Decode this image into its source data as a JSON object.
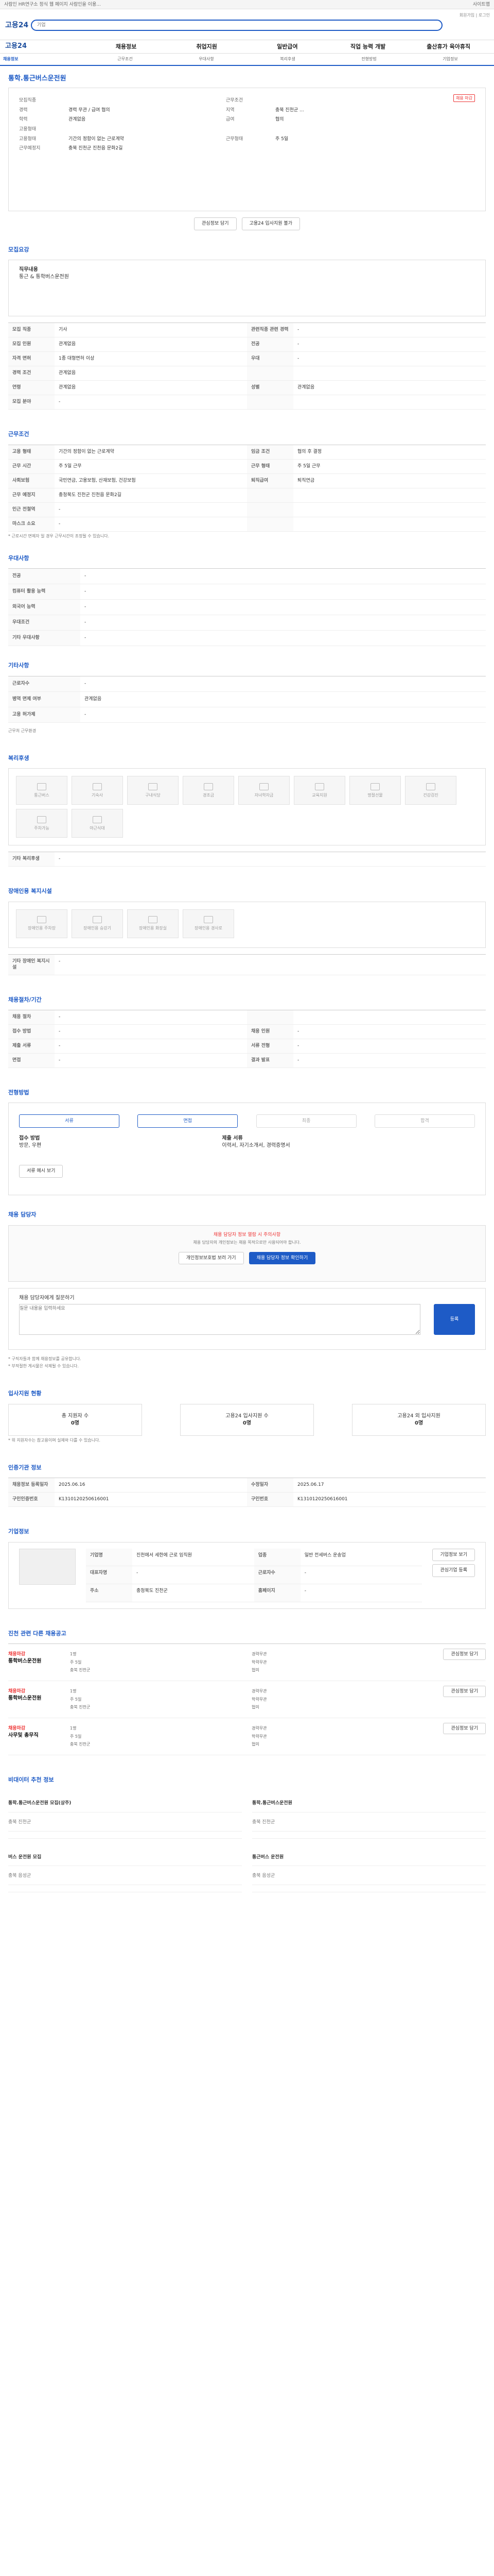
{
  "banner": {
    "text": "사람인 HR연구소 정식 웹 페이지 사람인을 이용...",
    "right": "사이트맵"
  },
  "header": {
    "logo": "고용24",
    "search_placeholder": "기업",
    "links": "회원가입 | 로그인"
  },
  "nav": {
    "items": [
      "고용24",
      "채용정보",
      "취업지원",
      "일반급여",
      "직업 능력 개발",
      "출산휴가 육아휴직"
    ]
  },
  "tabs": {
    "items": [
      "채용정보",
      "근무조건",
      "우대사항",
      "복리후생",
      "전형방법",
      "기업정보"
    ]
  },
  "job": {
    "title": "통학.통근버스운전원",
    "badge": "채용 마감",
    "summary": [
      [
        "모집직종",
        "",
        "근무조건",
        ""
      ],
      [
        "경력",
        "경력 무관 / 급여 협의",
        "지역",
        "충북 진천군 ..."
      ],
      [
        "학력",
        "관계없음",
        "급여",
        "협의"
      ],
      [
        "고용형태",
        "",
        "",
        ""
      ],
      [
        "고용형태",
        "기간의 정함이 없는 근로계약",
        "근무형태",
        "주 5일"
      ],
      [
        "근무예정지",
        "충북 진천군 진천읍 문화2길",
        "",
        ""
      ]
    ]
  },
  "buttons": {
    "save": "관심정보 담기",
    "apply": "고용24 입사지원 불가"
  },
  "recruit": {
    "heading": "모집요강",
    "desc_label": "직무내용",
    "desc": "통근 & 통학버스운전원",
    "rows": [
      [
        "모집 직종",
        "기사",
        "관련직종 관련 경력",
        "-"
      ],
      [
        "모집 인원",
        "관계없음",
        "전공",
        "-"
      ],
      [
        "자격 면허",
        "1종 대형면허 이상",
        "우대",
        "-"
      ],
      [
        "경력 조건",
        "관계없음",
        "",
        ""
      ],
      [
        "연령",
        "관계없음",
        "성별",
        "관계없음"
      ],
      [
        "모집 분야",
        "-",
        "",
        ""
      ]
    ]
  },
  "conditions": {
    "heading": "근무조건",
    "rows": [
      [
        "고용 형태",
        "기간의 정함이 없는 근로계약",
        "임금 조건",
        "협의 후 결정"
      ],
      [
        "근무 시간",
        "주 5일 근무",
        "근무 형태",
        "주 5일 근무"
      ],
      [
        "사회보험",
        "국민연금, 고용보험, 산재보험, 건강보험",
        "퇴직급여",
        "퇴직연금"
      ],
      [
        "근무 예정지",
        "충청북도 진천군 진천읍 문화2길",
        "",
        ""
      ],
      [
        "인근 전철역",
        "-",
        "",
        ""
      ],
      [
        "마스크 소요",
        "-",
        "",
        ""
      ]
    ],
    "note": "* 근로시간 면제자 일 경우 근무시간이 조정될 수 있습니다."
  },
  "prefs": {
    "heading": "우대사항",
    "rows": [
      [
        "전공",
        "-"
      ],
      [
        "컴퓨터 활용 능력",
        "-"
      ],
      [
        "외국어 능력",
        "-"
      ],
      [
        "우대조건",
        "-"
      ],
      [
        "기타 우대사항",
        "-"
      ]
    ]
  },
  "other": {
    "heading": "기타사항",
    "rows": [
      [
        "근로자수",
        "-"
      ],
      [
        "병역 면제 여부",
        "관계없음"
      ],
      [
        "고용 허가제",
        "-"
      ]
    ],
    "note": "근무처 근무환경"
  },
  "welfare": {
    "heading": "복리후생",
    "items": [
      "통근버스",
      "기숙사",
      "구내식당",
      "경조금",
      "자녀학자금",
      "교육지원",
      "명절선물",
      "건강검진",
      "주차가능",
      "야근식대"
    ],
    "etc_label": "기타 복리후생",
    "etc": "-"
  },
  "disabled": {
    "heading": "장애인용 복지시설",
    "items": [
      "장애인용 주차장",
      "장애인용 승강기",
      "장애인용 화장실",
      "장애인용 경사로"
    ],
    "etc_label": "기타 장애인 복지시설",
    "etc": "-"
  },
  "process": {
    "heading": "채용절차/기간",
    "rows": [
      [
        "채용 절차",
        "-",
        "",
        ""
      ],
      [
        "접수 방법",
        "-",
        "채용 인원",
        "-"
      ],
      [
        "제출 서류",
        "-",
        "서류 전형",
        "-"
      ],
      [
        "면접",
        "-",
        "결과 발표",
        "-"
      ]
    ]
  },
  "screen": {
    "heading": "전형방법",
    "steps": [
      "서류",
      "면접",
      "최종",
      "합격"
    ],
    "method_label": "접수 방법",
    "method": "방문, 우편",
    "doc_label": "제출 서류",
    "doc": "이력서, 자기소개서, 경력증명서",
    "more": "서류 예시 보기"
  },
  "contact": {
    "heading": "채용 담당자",
    "warn": "채용 담당자 정보 열람 시 주의사항",
    "text": "채용 담당자의 개인정보는 채용 목적으로만 사용되어야 합니다.",
    "btn1": "개인정보보호법 보러 가기",
    "btn2": "채용 담당자 정보 확인하기"
  },
  "inquiry": {
    "label": "채용 담당자에게 질문하기",
    "placeholder": "질문 내용을 입력하세요",
    "send": "등록",
    "notes": [
      "* 구직자들과 함께 채용정보를 공유합니다.",
      "* 부적절한 게시물은 삭제될 수 있습니다."
    ]
  },
  "stats": {
    "heading": "입사지원 현황",
    "items": [
      [
        "총 지원자 수",
        "0명"
      ],
      [
        "고용24 입사지원 수",
        "0명"
      ],
      [
        "고용24 외 입사지원",
        "0명"
      ]
    ],
    "note": "* 위 지원자수는 참고용이며 실제와 다를 수 있습니다."
  },
  "meta": {
    "heading": "인증기관 정보",
    "rows": [
      [
        "채용정보 등록일자",
        "2025.06.16",
        "수정일자",
        "2025.06.17"
      ],
      [
        "구인인증번호",
        "K1310120250616001",
        "구인번호",
        "K1310120250616001"
      ]
    ]
  },
  "company": {
    "heading": "기업정보",
    "rows": [
      [
        "기업명",
        "진천에서 세한에 근로 임직원",
        "업종",
        "일반 전세버스 운송업"
      ],
      [
        "대표자명",
        "-",
        "근로자수",
        "-"
      ],
      [
        "주소",
        "충청북도 진천군",
        "홈페이지",
        "-"
      ]
    ],
    "btns": [
      "기업정보 보기",
      "관심기업 등록"
    ]
  },
  "related": {
    "heading": "진천 관련 다른 채용공고",
    "jobs": [
      {
        "tag": "채용마감",
        "name": "통학버스운전원",
        "info": [
          "1명",
          "경력무관",
          "주 5일",
          "학력무관",
          "충북 진천군",
          "협의"
        ]
      },
      {
        "tag": "채용마감",
        "name": "통학버스운전원",
        "info": [
          "1명",
          "경력무관",
          "주 5일",
          "학력무관",
          "충북 진천군",
          "협의"
        ]
      },
      {
        "tag": "채용마감",
        "name": "사무및 총무직",
        "info": [
          "1명",
          "경력무관",
          "주 5일",
          "학력무관",
          "충북 진천군",
          "협의"
        ]
      }
    ],
    "action": "관심정보 담기"
  },
  "recommend": {
    "heading": "비대이터 추천 정보",
    "items": [
      [
        "통학.통근버스운전원 모집(상주)",
        "충북 진천군"
      ],
      [
        "통학.통근버스운전원",
        "충북 진천군"
      ],
      [
        "버스 운전원 모집",
        "충북 음성군"
      ],
      [
        "통근버스 운전원",
        "충북 음성군"
      ]
    ]
  }
}
